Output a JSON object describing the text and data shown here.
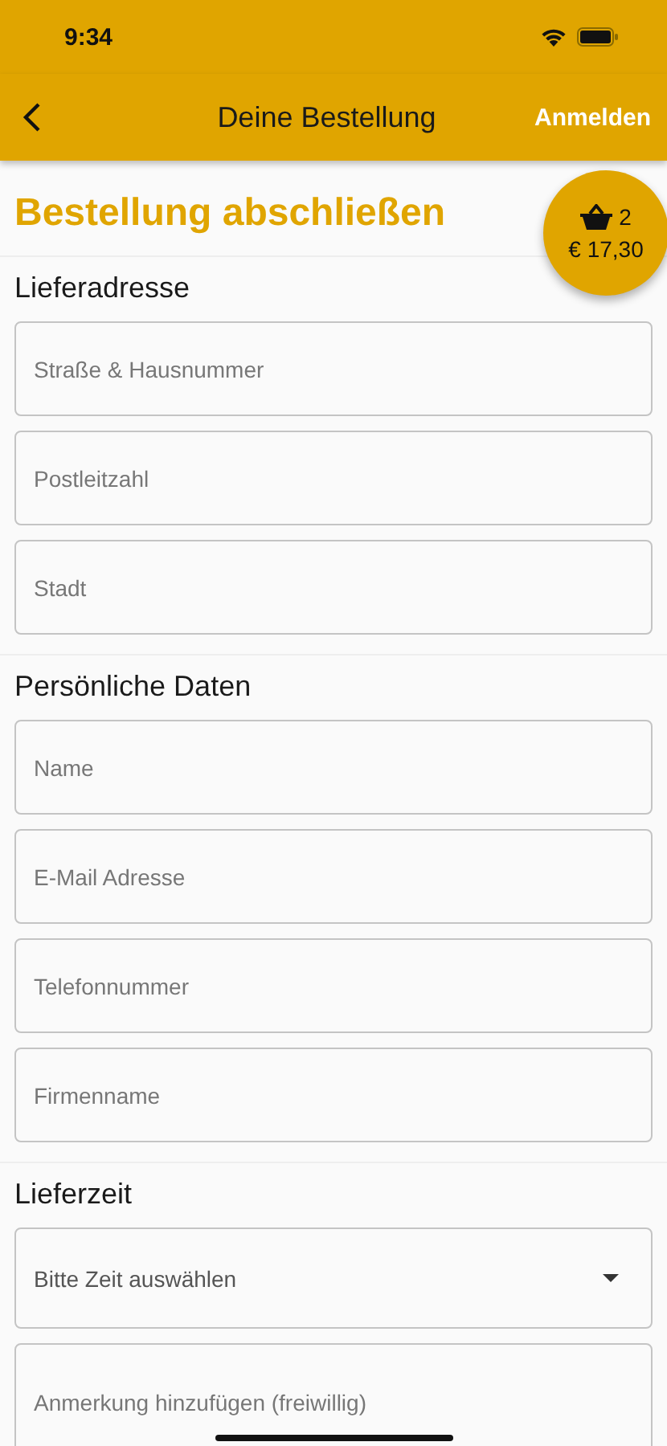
{
  "status_bar": {
    "time": "9:34"
  },
  "nav_bar": {
    "title": "Deine Bestellung",
    "action": "Anmelden"
  },
  "cart": {
    "count": "2",
    "total": "€ 17,30"
  },
  "page_title": "Bestellung abschließen",
  "sections": [
    {
      "title": "Lieferadresse",
      "fields": [
        {
          "kind": "input",
          "placeholder": "Straße & Hausnummer"
        },
        {
          "kind": "input",
          "placeholder": "Postleitzahl"
        },
        {
          "kind": "input",
          "placeholder": "Stadt"
        }
      ]
    },
    {
      "title": "Persönliche Daten",
      "fields": [
        {
          "kind": "input",
          "placeholder": "Name"
        },
        {
          "kind": "input",
          "placeholder": "E-Mail Adresse"
        },
        {
          "kind": "input",
          "placeholder": "Telefonnummer"
        },
        {
          "kind": "input",
          "placeholder": "Firmenname"
        }
      ]
    },
    {
      "title": "Lieferzeit",
      "fields": [
        {
          "kind": "dropdown",
          "placeholder": "Bitte Zeit auswählen"
        },
        {
          "kind": "textarea",
          "placeholder": "Anmerkung hinzufügen (freiwillig)"
        }
      ]
    }
  ]
}
